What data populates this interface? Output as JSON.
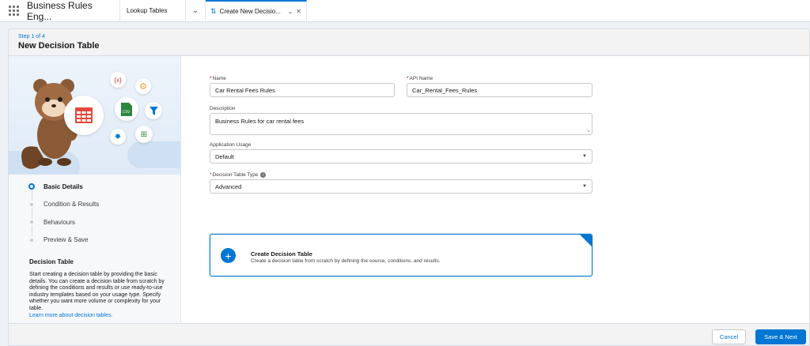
{
  "nav": {
    "app_name": "Business Rules Eng...",
    "tabs": [
      {
        "label": "Lookup Tables"
      },
      {
        "label": "Create New Decisio..."
      }
    ]
  },
  "header": {
    "step": "Step 1 of 4",
    "title": "New Decision Table"
  },
  "sidebar": {
    "steps": [
      {
        "label": "Basic Details",
        "state": "current"
      },
      {
        "label": "Condition & Results",
        "state": "upcoming"
      },
      {
        "label": "Behaviours",
        "state": "upcoming"
      },
      {
        "label": "Preview & Save",
        "state": "upcoming"
      }
    ],
    "help_title": "Decision Table",
    "help_text": "Start creating a decision table by providing the basic details. You can create a decision table from scratch by defining the conditions and results or use ready-to-use industry templates based on your usage type. Specify whether you want more volume or complexity for your table.",
    "help_link": "Learn more about decision tables."
  },
  "form": {
    "name": {
      "label": "Name",
      "value": "Car Rental Fees Rules",
      "required": true
    },
    "api_name": {
      "label": "API Name",
      "value": "Car_Rental_Fees_Rules",
      "required": true
    },
    "description": {
      "label": "Description",
      "value": "Business Rules for car rental fees"
    },
    "application_usage": {
      "label": "Application Usage",
      "value": "Default"
    },
    "decision_table_type": {
      "label": "Decision Table Type",
      "value": "Advanced",
      "required": true
    },
    "option": {
      "title": "Create Decision Table",
      "description": "Create a decision table from scratch by defining the source, conditions, and results.",
      "selected": true
    }
  },
  "footer": {
    "cancel_label": "Cancel",
    "save_label": "Save & Next"
  },
  "colors": {
    "brand": "#0176d3",
    "required": "#ba0517"
  }
}
